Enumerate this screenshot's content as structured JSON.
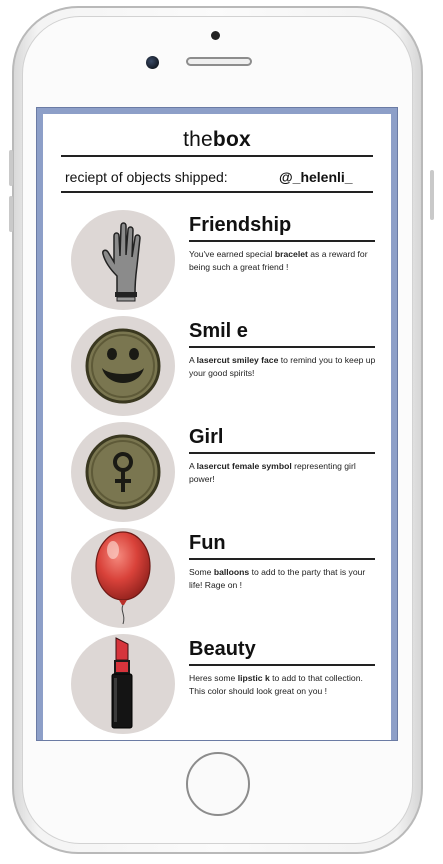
{
  "app": {
    "brand_prefix": "the",
    "brand_bold": "box"
  },
  "receipt": {
    "label": "reciept of objects shipped:",
    "handle": "@_helenli_"
  },
  "items": [
    {
      "title": "Friendship",
      "desc_before": "You've earned special ",
      "desc_bold": "bracelet",
      "desc_after": " as a reward for being such a great friend !",
      "icon": "glove-icon"
    },
    {
      "title": "Smil e",
      "desc_before": "A ",
      "desc_bold": "lasercut smiley face",
      "desc_after": " to remind you to keep up your good spirits!",
      "icon": "smiley-face-icon"
    },
    {
      "title": "Girl",
      "desc_before": "A ",
      "desc_bold": "lasercut female symbol",
      "desc_after": " representing girl power!",
      "icon": "female-symbol-icon"
    },
    {
      "title": "Fun",
      "desc_before": "Some ",
      "desc_bold": "balloons",
      "desc_after": " to add to the party that is your life! Rage on !",
      "icon": "balloon-icon"
    },
    {
      "title": "Beauty",
      "desc_before": "Heres some ",
      "desc_bold": "lipstic k",
      "desc_after": " to add to that collection. This color should look great on you !",
      "icon": "lipstick-icon"
    }
  ],
  "colors": {
    "screen_frame": "#8d9fc8",
    "circle_bg": "#ddd7d5",
    "token_olive": "#7a7650",
    "balloon_red": "#d9423a",
    "lipstick_red": "#d6343c"
  }
}
